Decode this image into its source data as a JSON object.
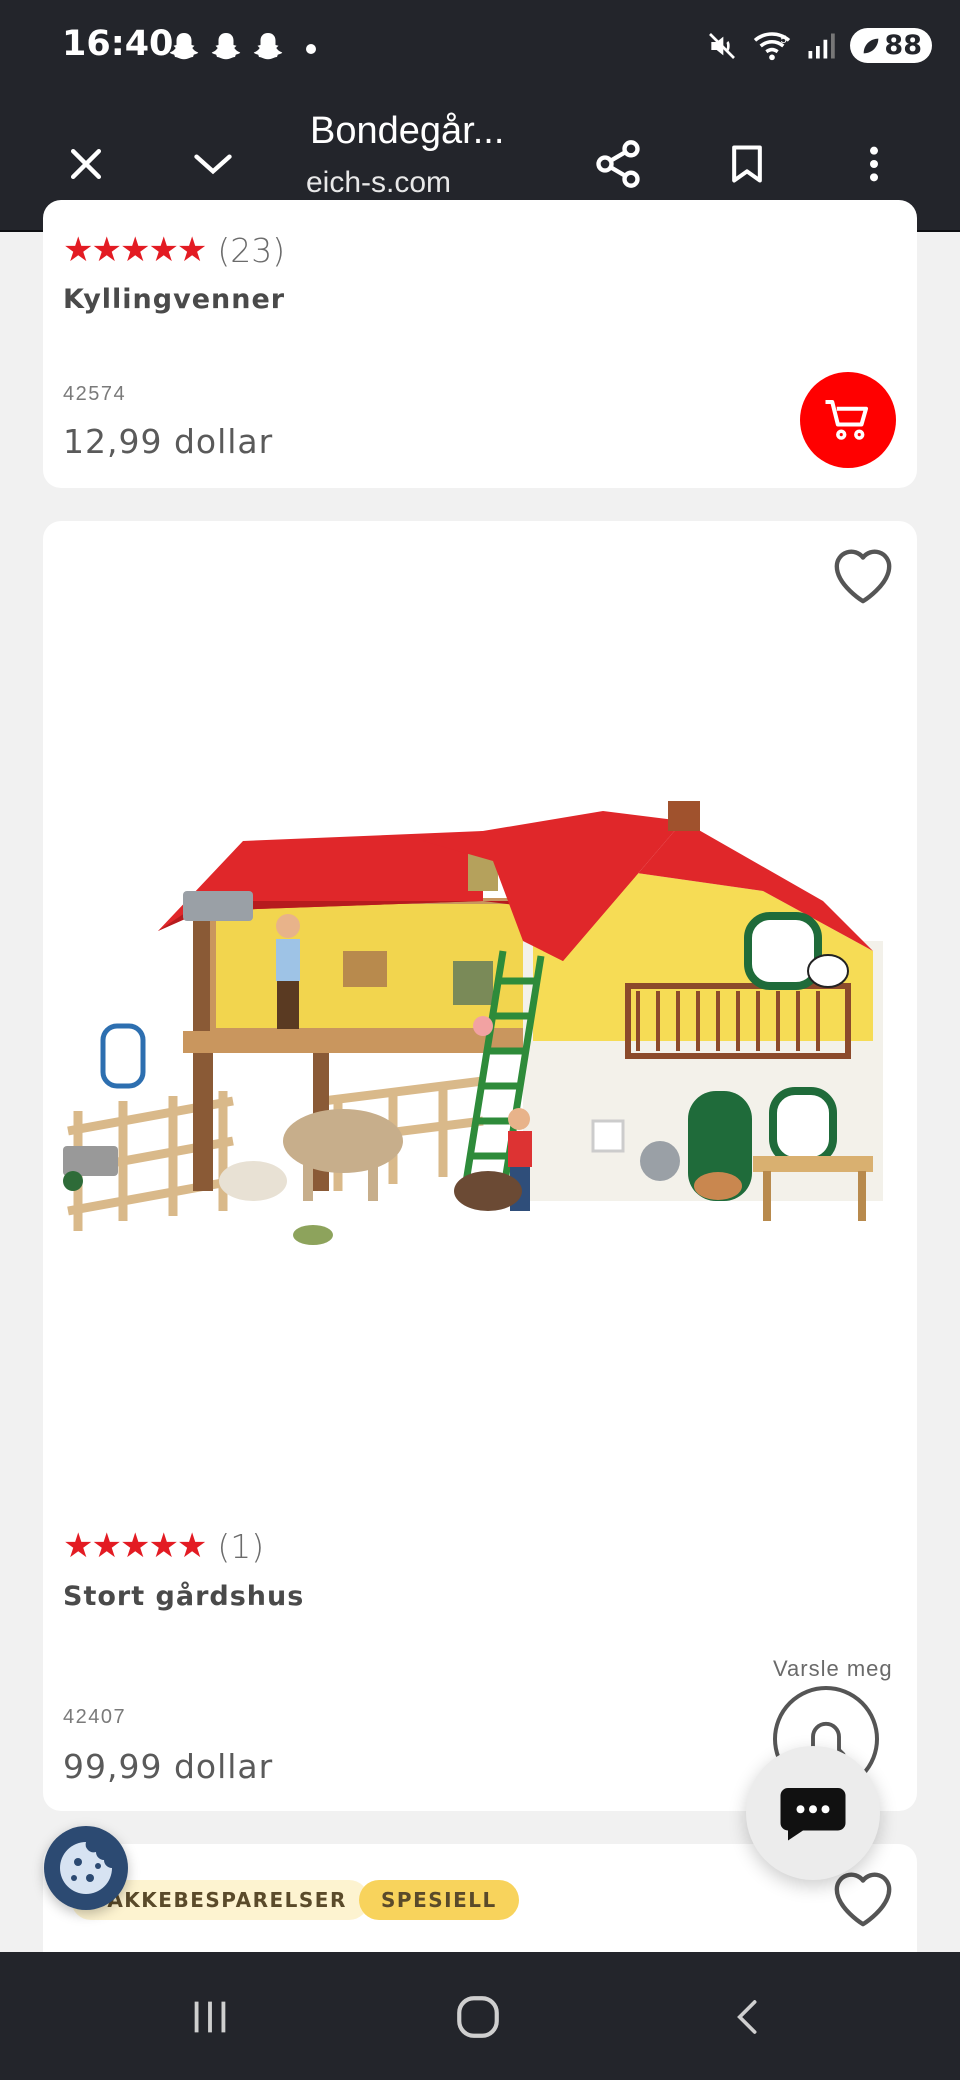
{
  "status": {
    "time": "16:40",
    "battery": "88",
    "network": "5"
  },
  "toolbar": {
    "title": "Bondegår...",
    "url": "eich-s.com"
  },
  "products": [
    {
      "rating_count": "(23)",
      "name": "Kyllingvenner",
      "sku": "42574",
      "price": "12,99 dollar"
    },
    {
      "rating_count": "(1)",
      "name": "Stort gårdshus",
      "sku": "42407",
      "price": "99,99 dollar",
      "notify_label": "Varsle meg"
    }
  ],
  "next_card": {
    "badges": [
      "PAKKEBESPARELSER",
      "SPESIELL"
    ]
  },
  "colors": {
    "accent": "#ff0000",
    "star": "#e31b23",
    "bar": "#23252b",
    "badge_savings": "#fdf3d0",
    "badge_special": "#f8d35c"
  },
  "icons": {
    "close": "close-icon",
    "collapse": "chevron-down-icon",
    "share": "share-icon",
    "bookmark": "bookmark-icon",
    "menu": "more-vert-icon",
    "cart": "cart-icon",
    "wishlist": "heart-icon",
    "notify": "bell-icon",
    "chat": "chat-icon",
    "cookie": "cookie-icon"
  }
}
